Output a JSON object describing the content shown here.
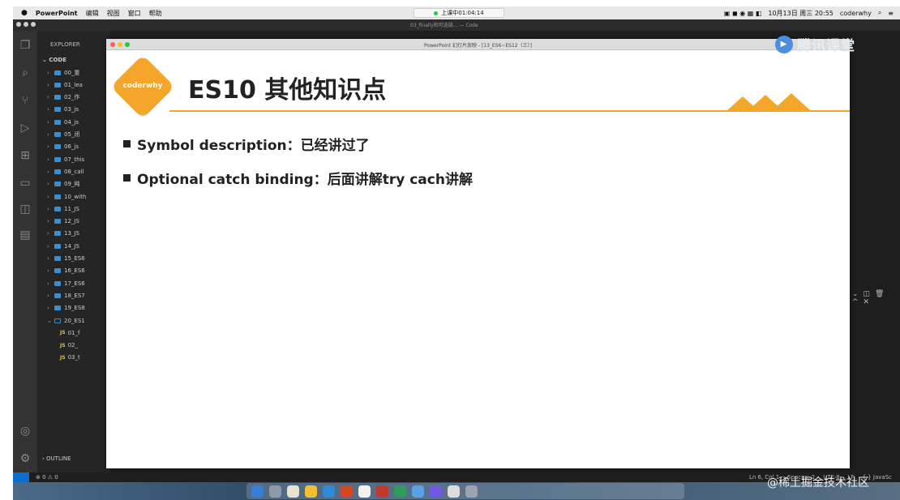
{
  "menubar": {
    "apple": "",
    "app": "PowerPoint",
    "items": [
      "编辑",
      "视图",
      "窗口",
      "帮助"
    ],
    "recording": "上课中01:04:14",
    "clock": "10月13日 周三 20:55",
    "user": "coderwhy"
  },
  "vscode": {
    "title_caption": "03_finally和可选链... — Code",
    "explorer_label": "EXPLORER",
    "workspace_label": "CODE",
    "tree": [
      {
        "label": "00_重",
        "type": "folder"
      },
      {
        "label": "01_lea",
        "type": "folder"
      },
      {
        "label": "02_作",
        "type": "folder"
      },
      {
        "label": "03_js",
        "type": "folder"
      },
      {
        "label": "04_js",
        "type": "folder"
      },
      {
        "label": "05_闭",
        "type": "folder"
      },
      {
        "label": "06_js",
        "type": "folder"
      },
      {
        "label": "07_this",
        "type": "folder"
      },
      {
        "label": "08_call",
        "type": "folder"
      },
      {
        "label": "09_纯",
        "type": "folder"
      },
      {
        "label": "10_with",
        "type": "folder"
      },
      {
        "label": "11_JS",
        "type": "folder"
      },
      {
        "label": "12_JS",
        "type": "folder"
      },
      {
        "label": "13_JS",
        "type": "folder"
      },
      {
        "label": "14_JS",
        "type": "folder"
      },
      {
        "label": "15_ES6",
        "type": "folder"
      },
      {
        "label": "16_ES6",
        "type": "folder"
      },
      {
        "label": "17_ES6",
        "type": "folder"
      },
      {
        "label": "18_ES7",
        "type": "folder"
      },
      {
        "label": "19_ES8",
        "type": "folder"
      },
      {
        "label": "20_ES1",
        "type": "open-folder"
      },
      {
        "label": "01_f",
        "type": "js"
      },
      {
        "label": "02_",
        "type": "js"
      },
      {
        "label": "03_t",
        "type": "js"
      }
    ],
    "outline_label": "OUTLINE",
    "status": {
      "errors": "⊗ 0 ⚠ 0",
      "position": "Ln 6, Col 1",
      "spaces": "Spaces: 2",
      "encoding": "UTF-8",
      "eol": "LF",
      "language": "{ } JavaSc"
    }
  },
  "watermarks": {
    "tencent": "腾讯课堂",
    "juejin": "@稀土掘金技术社区"
  },
  "ppt": {
    "window_title": "PowerPoint 幻灯片放映 - [13_ES6~ES12（三）]",
    "logo_text": "coderwhy",
    "slide_title": "ES10 其他知识点",
    "bullets": [
      "Symbol description：已经讲过了",
      "Optional catch binding：后面讲解try cach讲解"
    ]
  },
  "colors": {
    "accent": "#f4a62a",
    "vscode_bg": "#1e1e1e",
    "sidebar_bg": "#252526",
    "activity_bg": "#333333",
    "folder": "#3b8ed0",
    "js": "#e8c33a"
  }
}
